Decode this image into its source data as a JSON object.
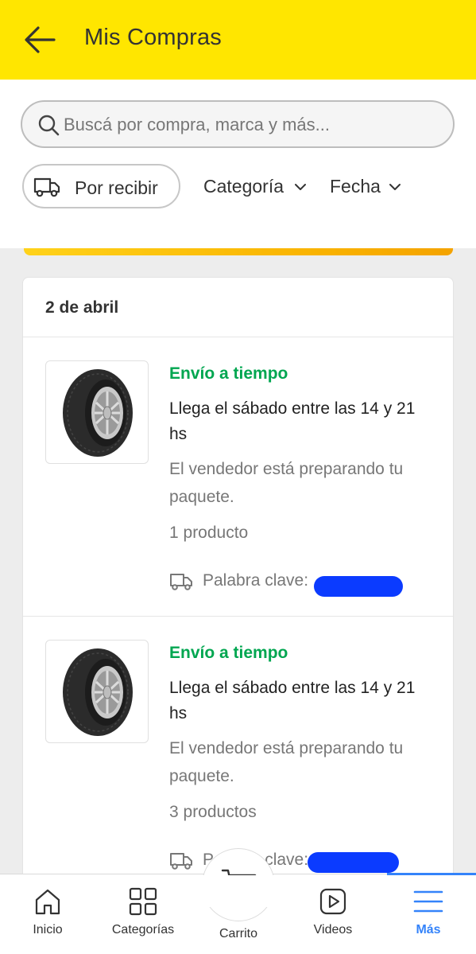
{
  "header": {
    "title": "Mis Compras"
  },
  "search": {
    "placeholder": "Buscá por compra, marca y más..."
  },
  "filters": {
    "chip_label": "Por recibir",
    "category_label": "Categoría",
    "date_label": "Fecha"
  },
  "group": {
    "date": "2 de abril",
    "orders": [
      {
        "status": "Envío a tiempo",
        "eta": "Llega el sábado entre las 14 y 21 hs",
        "message": "El vendedor está preparando tu paquete.",
        "count": "1 producto",
        "keyword_label": "Palabra clave:"
      },
      {
        "status": "Envío a tiempo",
        "eta": "Llega el sábado entre las 14 y 21 hs",
        "message": "El vendedor está preparando tu paquete.",
        "count": "3 productos",
        "keyword_label": "Palabra clave:"
      }
    ]
  },
  "tabbar": {
    "home": "Inicio",
    "categories": "Categorías",
    "cart": "Carrito",
    "videos": "Videos",
    "more": "Más"
  },
  "colors": {
    "brand_yellow": "#ffe600",
    "status_green": "#00a650",
    "accent_blue": "#3483fa"
  },
  "icons": [
    "back-arrow-icon",
    "search-icon",
    "truck-icon",
    "chevron-down-icon",
    "home-icon",
    "grid-icon",
    "cart-icon",
    "play-icon",
    "menu-icon"
  ]
}
